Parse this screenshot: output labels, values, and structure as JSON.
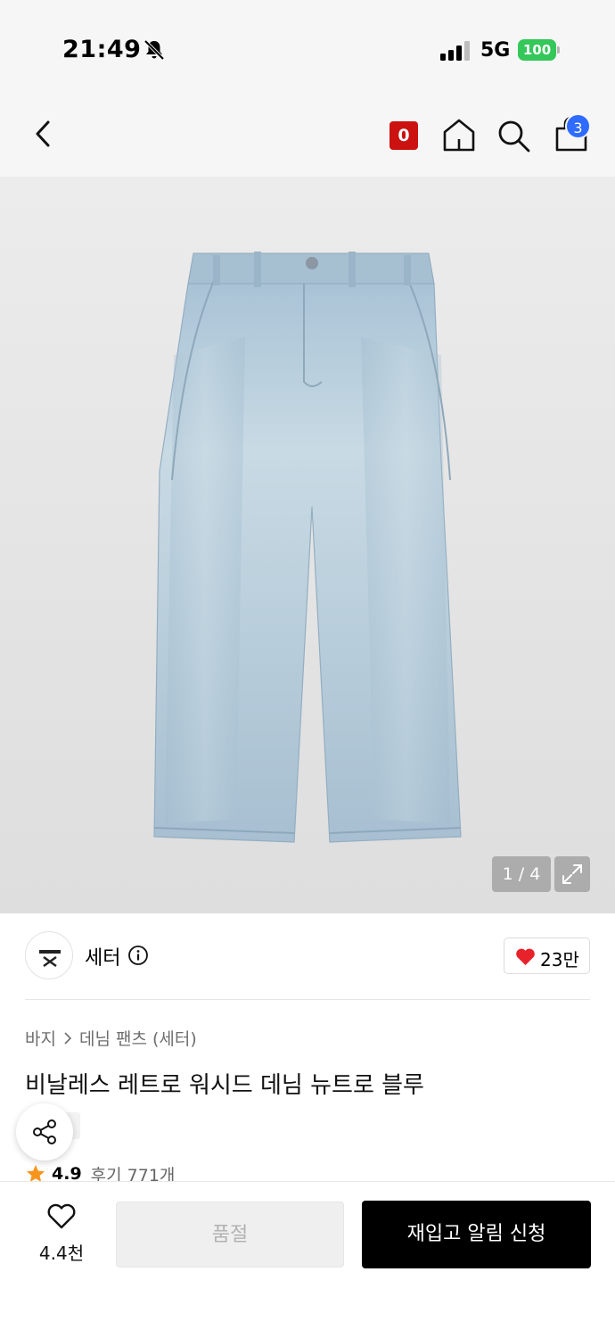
{
  "status_bar": {
    "time": "21:49",
    "network": "5G",
    "battery": "100"
  },
  "header": {
    "points_badge": "0",
    "cart_count": "3"
  },
  "gallery": {
    "counter": "1 / 4"
  },
  "brand": {
    "name": "세터",
    "likes": "23만"
  },
  "breadcrumb": {
    "category": "바지",
    "subcategory": "데님 팬츠 (세터)"
  },
  "product": {
    "title": "비날레스 레트로 워시드 데님 뉴트로 블루",
    "rating": "4.9",
    "reviews": "후기 771개"
  },
  "bottom_bar": {
    "wish_count": "4.4천",
    "soldout_label": "품절",
    "restock_label": "재입고 알림 신청"
  },
  "colors": {
    "like_red": "#e8222b",
    "points_red": "#cc1111",
    "cart_badge_blue": "#2f6bff",
    "battery_green": "#34c759",
    "star_orange": "#f7941d"
  }
}
